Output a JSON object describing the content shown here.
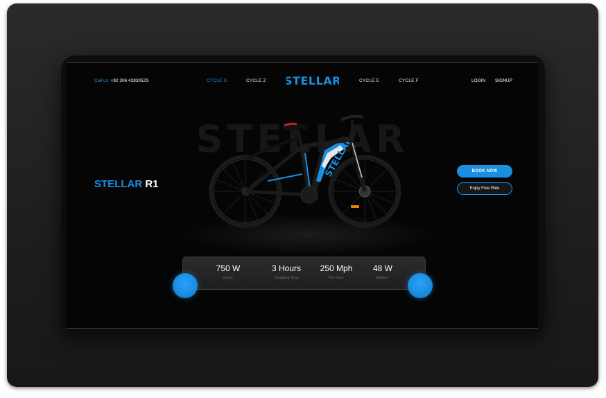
{
  "header": {
    "call_label": "Call us:",
    "phone": "+92 306 4283052S",
    "logo_text": "STELLAR",
    "nav": [
      "CYCLE S",
      "CYCLE Z",
      "CYCLE E",
      "CYCLE F"
    ],
    "login": "LOGIN",
    "signup": "SIGNUP"
  },
  "hero": {
    "background_word": "STELLAR",
    "product_brand": "STELLAR",
    "product_model": "R1",
    "bike_decal": "STELLAR"
  },
  "actions": {
    "book_now": "BOOK NOW",
    "free_ride": "Enjoy Free Ride"
  },
  "stats": [
    {
      "value": "750 W",
      "label": "motor"
    },
    {
      "value": "3 Hours",
      "label": "Charging Time"
    },
    {
      "value": "250 Mph",
      "label": "Per Hour"
    },
    {
      "value": "48 W",
      "label": "Battery"
    }
  ],
  "colors": {
    "accent": "#1a8fe0",
    "background": "#050505"
  }
}
